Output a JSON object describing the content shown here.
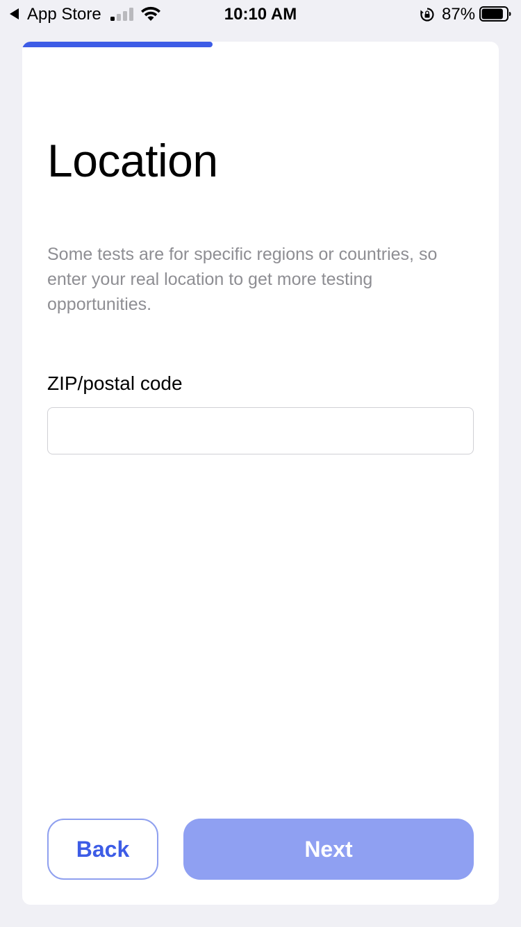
{
  "status_bar": {
    "back_app": "App Store",
    "time": "10:10 AM",
    "battery_percent": "87%",
    "signal_bars_active": 1,
    "signal_bars_total": 4,
    "battery_level": 0.87
  },
  "progress": {
    "fraction": 0.4,
    "color": "#3d5ce6"
  },
  "page": {
    "title": "Location",
    "description": "Some tests are for specific regions or countries, so enter your real location to get more testing opportunities."
  },
  "form": {
    "zip_label": "ZIP/postal code",
    "zip_value": "",
    "zip_placeholder": ""
  },
  "buttons": {
    "back_label": "Back",
    "next_label": "Next",
    "next_enabled": false
  },
  "colors": {
    "accent": "#3d5ce6",
    "button_disabled": "#8fa0f2",
    "background": "#f0f0f5",
    "muted_text": "#8e8e93"
  }
}
